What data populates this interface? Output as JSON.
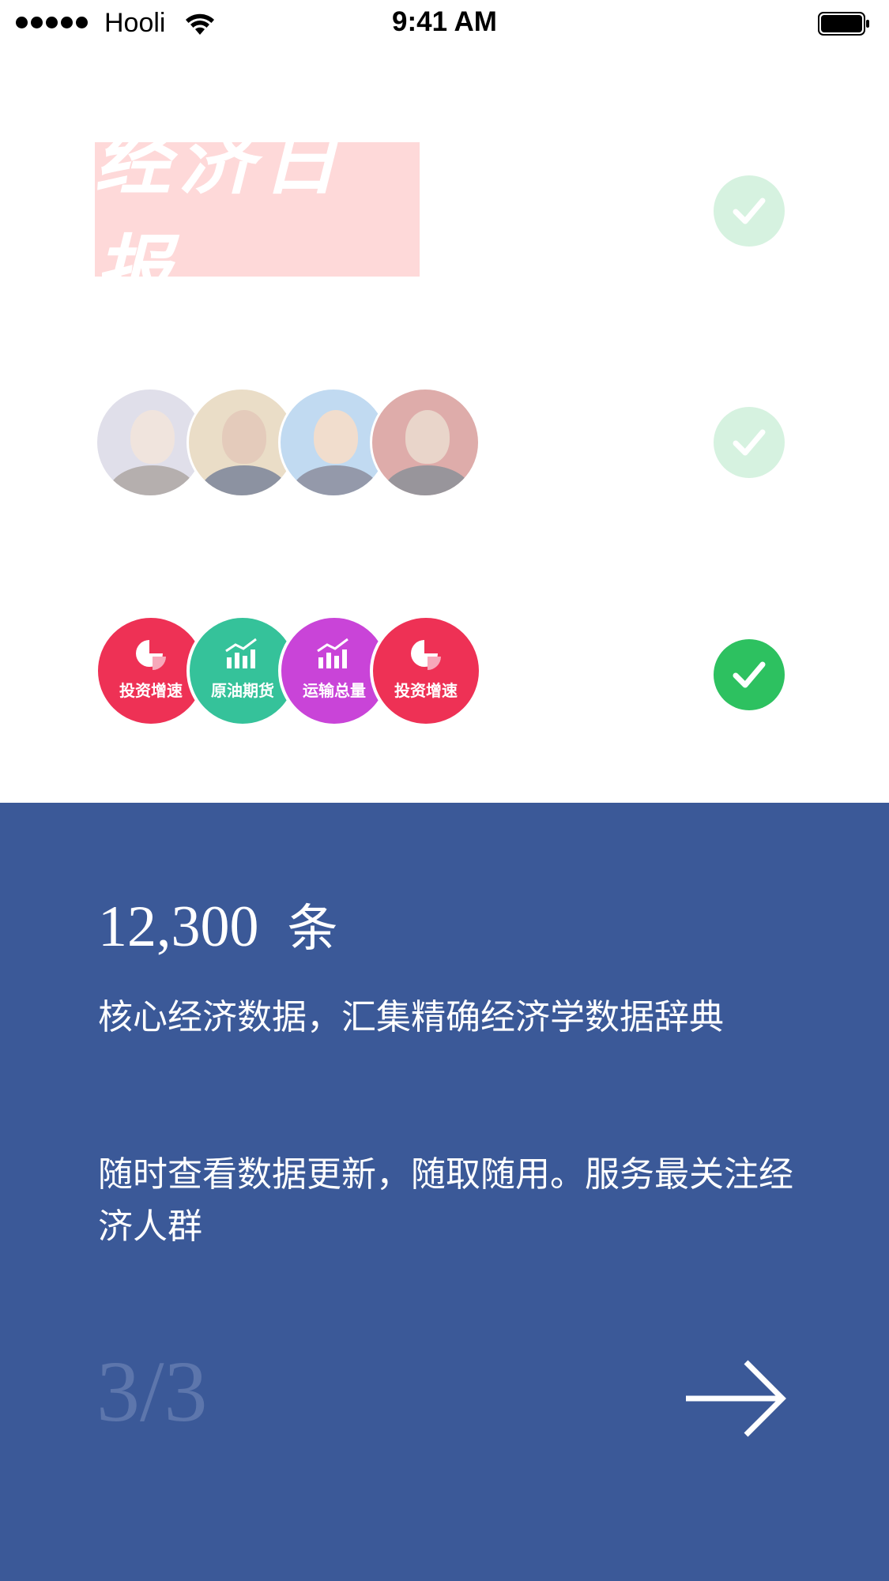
{
  "status_bar": {
    "carrier": "Hooli",
    "time": "9:41 AM"
  },
  "features": {
    "newspaper": {
      "logo_text": "经济日报",
      "checked": true,
      "check_color": "#d6f2e0"
    },
    "experts": {
      "checked": true,
      "check_color": "#d6f2e0"
    },
    "data_icons": {
      "checked": true,
      "check_color": "#2dc160",
      "items": [
        {
          "label": "投资增速",
          "icon": "pie-chart-icon",
          "color": "#ee3155"
        },
        {
          "label": "原油期货",
          "icon": "bar-chart-icon",
          "color": "#35c29a"
        },
        {
          "label": "运输总量",
          "icon": "bar-chart-icon",
          "color": "#c944d8"
        },
        {
          "label": "投资增速",
          "icon": "pie-chart-icon",
          "color": "#ee3155"
        }
      ]
    }
  },
  "panel": {
    "background": "#3b5998",
    "count": "12,300",
    "count_unit": "条",
    "description_1": "核心经济数据，汇集精确经济学数据辞典",
    "description_2": "随时查看数据更新，随取随用。服务最关注经济人群",
    "pager": "3/3"
  }
}
